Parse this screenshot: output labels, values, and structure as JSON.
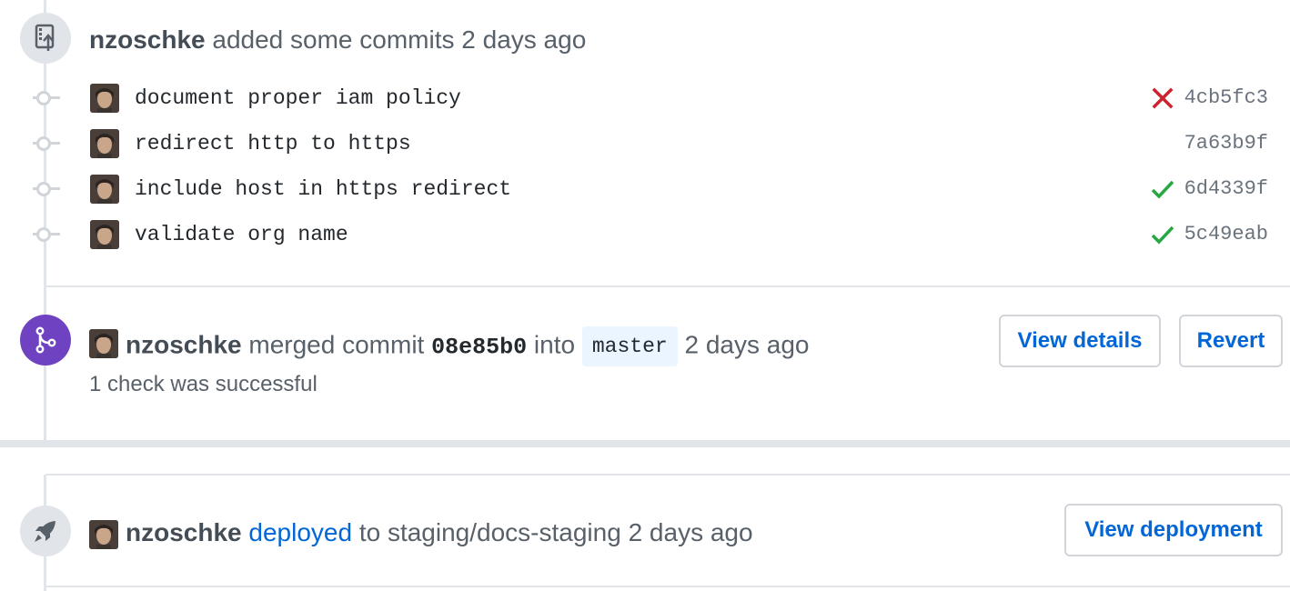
{
  "commits_event": {
    "author": "nzoschke",
    "action": "added some commits",
    "time": "2 days ago",
    "commits": [
      {
        "message": "document proper iam policy",
        "sha": "4cb5fc3",
        "status": "failure"
      },
      {
        "message": "redirect http to https",
        "sha": "7a63b9f",
        "status": "none"
      },
      {
        "message": "include host in https redirect",
        "sha": "6d4339f",
        "status": "success"
      },
      {
        "message": "validate org name",
        "sha": "5c49eab",
        "status": "success"
      }
    ]
  },
  "merge_event": {
    "author": "nzoschke",
    "action": "merged commit",
    "sha": "08e85b0",
    "into": "into",
    "branch": "master",
    "time": "2 days ago",
    "checks": "1 check was successful",
    "view_details_label": "View details",
    "revert_label": "Revert"
  },
  "deploy_event": {
    "author": "nzoschke",
    "action_link": "deployed",
    "target": "to staging/docs-staging",
    "time": "2 days ago",
    "view_deployment_label": "View deployment"
  },
  "colors": {
    "link": "#0366d6",
    "merged": "#6f42c1",
    "success": "#28a745",
    "failure": "#cb2431",
    "border": "#e1e4e8"
  },
  "icons": {
    "commits_event": "repo-push-icon",
    "merge_event": "git-merge-icon",
    "deploy_event": "rocket-icon",
    "failure": "x-icon",
    "success": "check-icon",
    "commit_node": "git-commit-icon"
  }
}
